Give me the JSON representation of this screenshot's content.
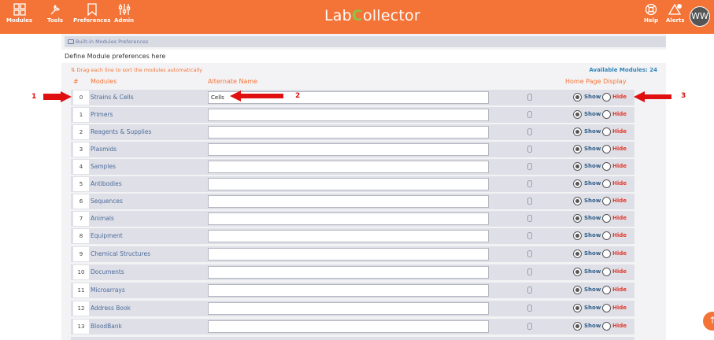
{
  "nav": {
    "left": [
      {
        "label": "Modules",
        "icon": "grid-icon"
      },
      {
        "label": "Tools",
        "icon": "wrench-icon"
      },
      {
        "label": "Preferences",
        "icon": "bookmark-icon"
      },
      {
        "label": "Admin",
        "icon": "sliders-icon"
      }
    ],
    "right": [
      {
        "label": "Help",
        "icon": "lifebuoy-icon"
      },
      {
        "label": "Alerts",
        "icon": "warning-icon"
      }
    ],
    "logo_left": "Lab",
    "logo_c": "C",
    "logo_right": "ollector",
    "avatar": "WW"
  },
  "breadcrumb": "Built-in Modules Preferences",
  "define_text": "Define Module preferences here",
  "drag_hint": "Drag each line to sort the modules automatically",
  "available": "Available Modules: 24",
  "headers": {
    "num": "#",
    "modules": "Modules",
    "alt": "Alternate Name",
    "home": "Home Page Display"
  },
  "show_label": "Show",
  "hide_label": "Hide",
  "rows": [
    {
      "num": "0",
      "name": "Strains & Cells",
      "alt": "Cells"
    },
    {
      "num": "1",
      "name": "Primers",
      "alt": ""
    },
    {
      "num": "2",
      "name": "Reagents & Supplies",
      "alt": ""
    },
    {
      "num": "3",
      "name": "Plasmids",
      "alt": ""
    },
    {
      "num": "4",
      "name": "Samples",
      "alt": ""
    },
    {
      "num": "5",
      "name": "Antibodies",
      "alt": ""
    },
    {
      "num": "6",
      "name": "Sequences",
      "alt": ""
    },
    {
      "num": "7",
      "name": "Animals",
      "alt": ""
    },
    {
      "num": "8",
      "name": "Equipment",
      "alt": ""
    },
    {
      "num": "9",
      "name": "Chemical Structures",
      "alt": ""
    },
    {
      "num": "10",
      "name": "Documents",
      "alt": ""
    },
    {
      "num": "11",
      "name": "Microarrays",
      "alt": ""
    },
    {
      "num": "12",
      "name": "Address Book",
      "alt": ""
    },
    {
      "num": "13",
      "name": "BloodBank",
      "alt": ""
    }
  ],
  "annotations": [
    "1",
    "2",
    "3"
  ],
  "colors": {
    "brand": "#f47336",
    "arrow": "#e01010",
    "link": "#4b6a9a"
  }
}
